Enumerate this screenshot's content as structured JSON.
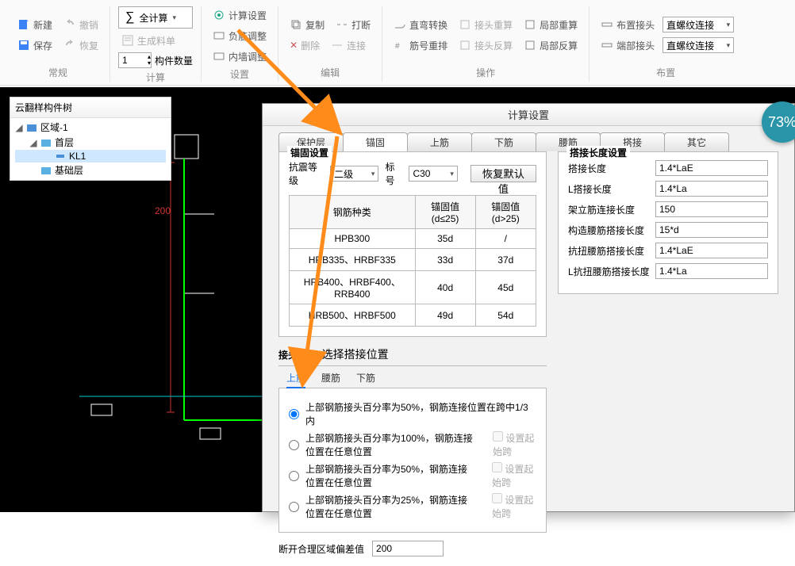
{
  "ribbon": {
    "groups": {
      "changgui": {
        "label": "常规",
        "new": "新建",
        "save": "保存",
        "undo": "撤销",
        "redo": "恢复"
      },
      "jisuan": {
        "label": "计算",
        "all_calc": "全计算",
        "gen_list": "生成料单",
        "qty_label": "构件数量",
        "qty_value": "1"
      },
      "shezhi": {
        "label": "设置",
        "calc_set": "计算设置",
        "fujin": "负筋调整",
        "neiqiang": "内墙调整"
      },
      "bianji": {
        "label": "编辑",
        "copy": "复制",
        "del": "删除",
        "break": "打断",
        "lianjie": "连接"
      },
      "caozuo": {
        "label": "操作",
        "zhiwan": "直弯转换",
        "jinhao": "筋号重排",
        "jietou_chong": "接头重算",
        "jietou_fan": "接头反算",
        "jubu_chong": "局部重算",
        "jubu_fan": "局部反算"
      },
      "buzhi": {
        "label": "布置",
        "buzhi_jietou": "布置接头",
        "duantou_jietou": "端部接头",
        "sel1": "直螺纹连接",
        "sel2": "直螺纹连接"
      }
    }
  },
  "tree": {
    "title": "云翻样构件树",
    "root": "区域-1",
    "l1": "首层",
    "l2": "KL1",
    "l3": "基础层"
  },
  "canvas": {
    "dim": "200"
  },
  "dialog": {
    "title": "计算设置",
    "tabs": [
      "保护层",
      "锚固",
      "上筋",
      "下筋",
      "腰筋",
      "搭接",
      "其它"
    ],
    "active_tab": 1,
    "left_fs_title": "锚固设置",
    "kangzhen_label": "抗震等级",
    "kangzhen_value": "二级",
    "biaohao_label": "标号",
    "biaohao_value": "C30",
    "reset_btn": "恢复默认值",
    "th": [
      "钢筋种类",
      "锚固值(d≤25)",
      "锚固值(d>25)"
    ],
    "rows": [
      [
        "HPB300",
        "35d",
        "/"
      ],
      [
        "HRB335、HRBF335",
        "33d",
        "37d"
      ],
      [
        "HRB400、HRBF400、RRB400",
        "40d",
        "45d"
      ],
      [
        "HRB500、HRBF500",
        "49d",
        "54d"
      ]
    ],
    "right_fs_title": "搭接长度设置",
    "kv": [
      [
        "搭接长度",
        "1.4*LaE"
      ],
      [
        "L搭接长度",
        "1.4*La"
      ],
      [
        "架立筋连接长度",
        "150"
      ],
      [
        "构造腰筋搭接长度",
        "15*d"
      ],
      [
        "抗扭腰筋搭接长度",
        "1.4*LaE"
      ],
      [
        "L抗扭腰筋搭接长度",
        "1.4*La"
      ]
    ],
    "section2_label_a": "接头设置",
    "section2_label_b": "选择搭接位置",
    "subtabs": [
      "上筋",
      "腰筋",
      "下筋"
    ],
    "radio_opts": [
      "上部钢筋接头百分率为50%，钢筋连接位置在跨中1/3内",
      "上部钢筋接头百分率为100%，钢筋连接位置在任意位置",
      "上部钢筋接头百分率为50%，钢筋连接位置在任意位置",
      "上部钢筋接头百分率为25%，钢筋连接位置在任意位置"
    ],
    "cb_label": "设置起始跨",
    "offset_label": "断开合理区域偏差值",
    "offset_value": "200"
  },
  "badge": "73%"
}
